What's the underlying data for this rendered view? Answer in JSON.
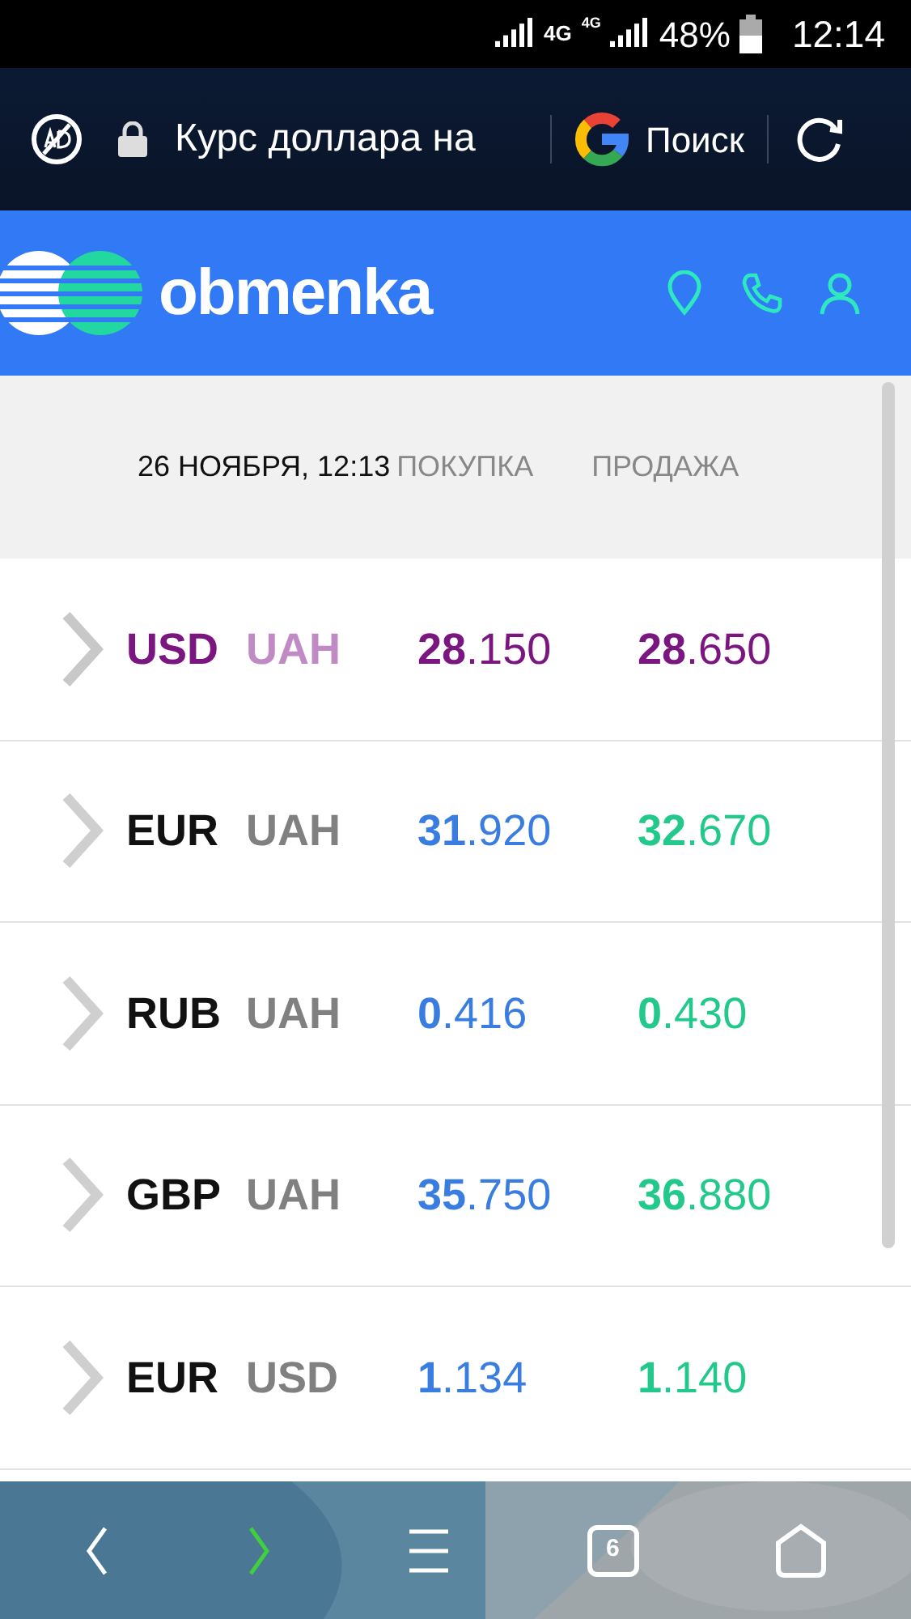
{
  "status_bar": {
    "network_1": "4G",
    "network_2": "4G",
    "battery": "48%",
    "time": "12:14"
  },
  "browser_bar": {
    "url": "Курс доллара на",
    "search": "Поиск"
  },
  "site_header": {
    "logo": "obmenka"
  },
  "table": {
    "date": "26 НОЯБРЯ, 12:13",
    "columns": [
      "ПОКУПКА",
      "ПРОДАЖА"
    ],
    "rows": [
      {
        "base": "USD",
        "quote": "UAH",
        "buy": "**28**.150",
        "sell": "**28**.650",
        "selected": true
      },
      {
        "base": "EUR",
        "quote": "UAH",
        "buy": "**31**.920",
        "sell": "**32**.670",
        "selected": false
      },
      {
        "base": "RUB",
        "quote": "UAH",
        "buy": "**0**.416",
        "sell": "**0**.430",
        "selected": false
      },
      {
        "base": "GBP",
        "quote": "UAH",
        "buy": "**35**.750",
        "sell": "**36**.880",
        "selected": false
      },
      {
        "base": "EUR",
        "quote": "USD",
        "buy": "**1**.134",
        "sell": "**1**.140",
        "selected": false
      }
    ]
  },
  "nav_bar": {
    "tab_count": "6"
  }
}
